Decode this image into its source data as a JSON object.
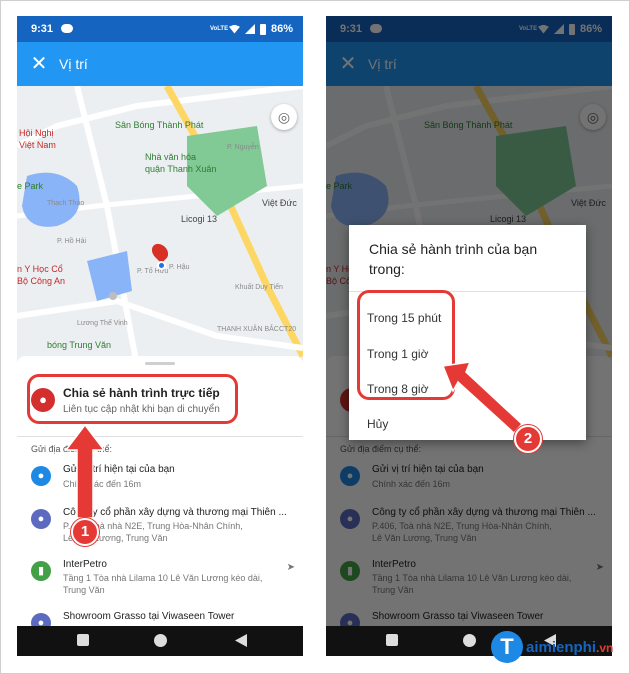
{
  "status_bar": {
    "time": "9:31",
    "volte": "VoLTE",
    "battery": "86%"
  },
  "app_bar": {
    "title": "Vị trí"
  },
  "map_labels": {
    "hoi_nghi": "Hội Nghị",
    "viet_nam": "Việt Nam",
    "san_bong": "Sân Bóng Thành Phát",
    "p_nguyen": "P. Nguyễn",
    "e_park": "e Park",
    "nha_van_hoa": "Nhà văn hóa",
    "quan_thanh_xuan": "quận Thanh Xuân",
    "viet_duc": "Việt Đức",
    "thach_thao": "Thạch Thảo",
    "licogi": "Licogi 13",
    "p_ho_hai": "P. Hồ Hải",
    "p_to_huu": "P. Tố Hữu",
    "p_hau": "P. Hậu",
    "hoc_vien": "n Y Học Cổ",
    "bo_cong_an": "Bộ Công An",
    "khuat_duy_tien": "Khuất Duy Tiến",
    "luong_the_vinh": "Lương Thế Vinh",
    "thanh_xuan_bac": "THANH XUÂN BẮC",
    "bong_trung_van": "bóng Trung Văn",
    "ct20": "CT20"
  },
  "sheet": {
    "live_share_title": "Chia sẻ hành trình trực tiếp",
    "live_share_subtitle": "Liên tục cập nhật khi bạn di chuyển",
    "send_label": "Gửi địa điểm cụ thể:",
    "places": [
      {
        "name": "Gửi vị trí hiện tại của bạn",
        "line1": "Chính xác đến 16m",
        "line2": "",
        "color": "#1e88e5"
      },
      {
        "name": "Công ty cổ phần xây dựng và thương mại Thiên ...",
        "line1": "P.406, Toà nhà N2E, Trung Hòa-Nhân Chính,",
        "line2": "Lê Văn Lương, Trung Văn",
        "color": "#5c6bc0"
      },
      {
        "name": "InterPetro",
        "line1": "Tầng 1 Tòa nhà Lilama 10 Lê Văn Lương kéo dài,",
        "line2": "Trung Văn",
        "color": "#43a047"
      },
      {
        "name": "Showroom Grasso tại Viwaseen Tower",
        "line1": "",
        "line2": "",
        "color": "#5c6bc0"
      }
    ]
  },
  "dialog": {
    "title": "Chia sẻ hành trình của bạn trong:",
    "options": [
      "Trong 15 phút",
      "Trong 1 giờ",
      "Trong 8 giờ"
    ],
    "cancel": "Hủy"
  },
  "callouts": {
    "step1": "1",
    "step2": "2"
  },
  "watermark": {
    "logo": "T",
    "brand": "aimienphi",
    "tld": ".vn"
  },
  "colors": {
    "primary": "#2196f3",
    "status": "#1565c0",
    "highlight": "#e53935"
  }
}
